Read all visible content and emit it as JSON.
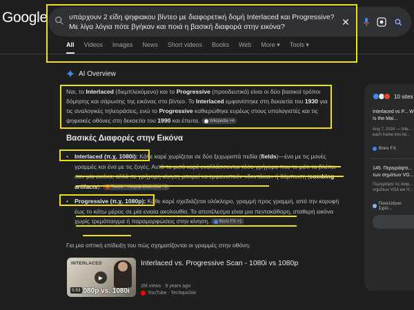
{
  "header": {
    "logo": "Google",
    "query": "υπάρχουν 2 είδη ψηφιακου βίντεο με διαφορετική δομή Interlaced και Progressive? Με λίγα λόγια πότε βγήκαν και ποιά η βασική διαφορά στην εικόνα?"
  },
  "tabs": [
    "All",
    "Videos",
    "Images",
    "News",
    "Short videos",
    "Books",
    "Web",
    "More ▾",
    "Tools ▾"
  ],
  "ai_overview": {
    "label": "AI Overview",
    "para": {
      "t1": "Ναι, το ",
      "b1": "Interlaced",
      "t2": " (διεμπλεκόμενο) και το ",
      "b2": "Progressive",
      "t3": " (προοδευτικό) είναι οι δύο βασικοί τρόποι δόμησης και σάρωσης της εικόνας στο βίντεο. Το ",
      "b3": "Interlaced",
      "t4": " εμφανίστηκε στη δεκαετία του ",
      "b4": "1930",
      "t5": " για τις αναλογικές τηλεοράσεις, ενώ το ",
      "b5": "Progressive",
      "t6": " καθιερώθηκε ευρέως στους υπολογιστές και τις ψηφιακές οθόνες στη δεκαετία του ",
      "b6": "1990",
      "t7": " και έπειτα.",
      "chip": "Wikipedia +4"
    },
    "heading": "Βασικές Διαφορές στην Εικόνα",
    "bullet1": {
      "title": "Interlaced (π.χ. 1080i):",
      "t1": " Κάθε καρέ χωρίζεται σε δύο ξεχωριστά πεδία (",
      "b1": "fields",
      "t2": ")—ένα με τις μονές γραμμές και ένα με τις ζυγές. Αυτά τα μισά καρέ εναλλάσσονται τόσο γρήγορα που το μάτι τα βλέπει σαν μία εικόνα, αλλά σε γρήγορη κίνηση μπορεί να εμφανιστούν «δοντάκια» ή θάμπωση (",
      "b2": "combing artifacts",
      "t3": ").",
      "chip": "Reddit · r/explainlikeimfive +3"
    },
    "bullet2": {
      "title": "Progressive (π.χ. 1080p):",
      "t1": " Κάθε καρέ σχεδιάζεται ολόκληρο, γραμμή προς γραμμή, από την κορυφή έως το κάτω μέρος σε μία ενιαία ακολουθία. Το αποτέλεσμα είναι μια πεντακάθαρη, σταθερή εικόνα χωρίς τρεμόπαιγμα ή παραμορφώσεις στην κίνηση.",
      "chip": "Boris FX +1"
    },
    "intro_video": "Για μια οπτική επίδειξη του πώς σχηματίζονται οι γραμμές στην οθόνη:"
  },
  "video": {
    "thumb_label": "INTERLACED",
    "thumb_caption": "1080p vs. 1080i",
    "duration": "5:53",
    "title": "Interlaced vs. Progressive Scan - 1080i vs 1080p",
    "meta": "2M views · 9 years ago",
    "source": "YouTube · Techquickie"
  },
  "panel": {
    "sites": "10 sites",
    "r1_title": "Interlaced vs P... What Is the Mai...",
    "r1_meta": "Aug 7, 2024 — Inte... each frame into tw...",
    "r1_src": "Boris FX",
    "r2_title": "145. Περιγράψτε... των σημάτων VG...",
    "r2_meta": "Περιγράψτε τις διαφ... σημάτων VGA και Η...",
    "r2_src": "Πανελλήνιο Σχολ..."
  },
  "colors": {
    "highlight": "#f2e21a",
    "background": "#1f1f1f",
    "accent_ai": "#4285f4"
  }
}
